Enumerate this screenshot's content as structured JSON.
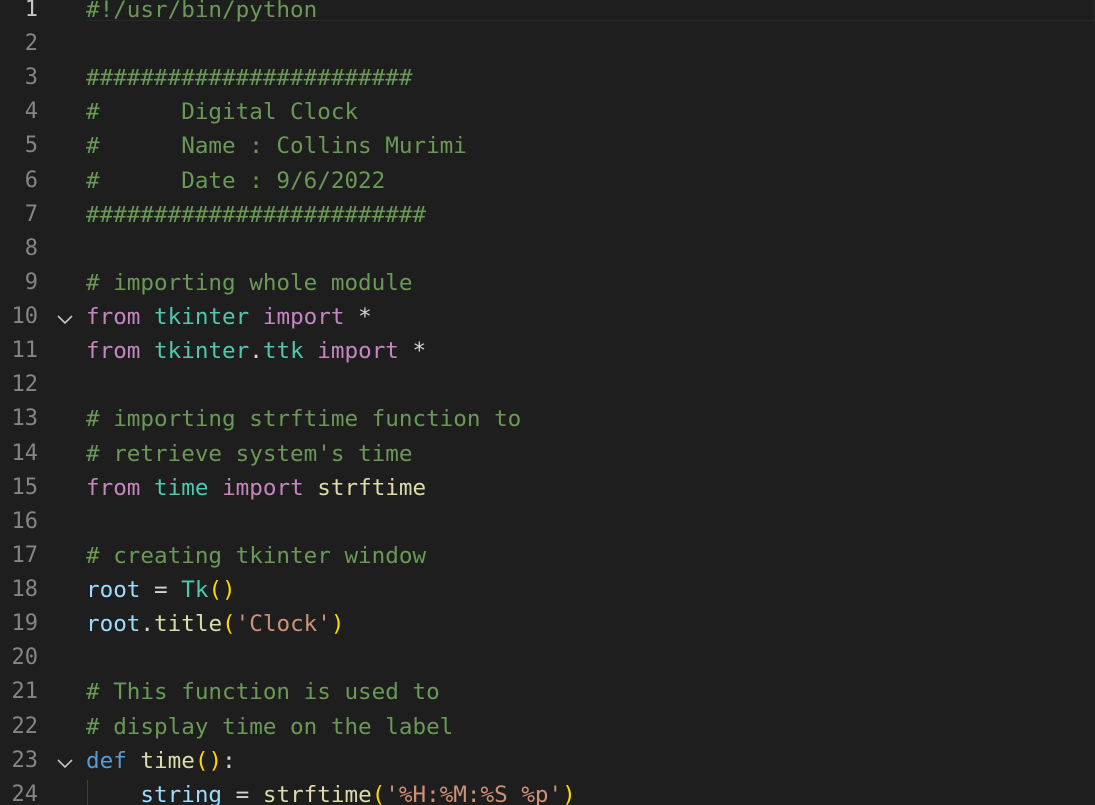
{
  "editor": {
    "theme_colors": {
      "background": "#1e1e1e",
      "line_number": "#858585",
      "comment": "#6a9955",
      "keyword": "#c586c0",
      "module": "#4ec9b0",
      "variable": "#9cdcfe",
      "function": "#dcdcaa",
      "string": "#ce9178",
      "bracket": "#ffd700"
    },
    "current_line": 1,
    "lines": [
      {
        "num": "1",
        "fold": "",
        "tokens": [
          {
            "t": "#!/usr/bin/python",
            "c": "comment"
          }
        ]
      },
      {
        "num": "2",
        "fold": "",
        "tokens": []
      },
      {
        "num": "3",
        "fold": "",
        "tokens": [
          {
            "t": "########################",
            "c": "comment"
          }
        ]
      },
      {
        "num": "4",
        "fold": "",
        "tokens": [
          {
            "t": "#      Digital Clock",
            "c": "comment"
          }
        ]
      },
      {
        "num": "5",
        "fold": "",
        "tokens": [
          {
            "t": "#      Name : Collins Murimi",
            "c": "comment"
          }
        ]
      },
      {
        "num": "6",
        "fold": "",
        "tokens": [
          {
            "t": "#      Date : 9/6/2022",
            "c": "comment"
          }
        ]
      },
      {
        "num": "7",
        "fold": "",
        "tokens": [
          {
            "t": "#########################",
            "c": "comment"
          }
        ]
      },
      {
        "num": "8",
        "fold": "",
        "tokens": []
      },
      {
        "num": "9",
        "fold": "",
        "tokens": [
          {
            "t": "# importing whole module",
            "c": "comment"
          }
        ]
      },
      {
        "num": "10",
        "fold": "chevron-down",
        "tokens": [
          {
            "t": "from",
            "c": "keyword"
          },
          {
            "t": " ",
            "c": "plain"
          },
          {
            "t": "tkinter",
            "c": "module"
          },
          {
            "t": " ",
            "c": "plain"
          },
          {
            "t": "import",
            "c": "keyword"
          },
          {
            "t": " *",
            "c": "plain"
          }
        ]
      },
      {
        "num": "11",
        "fold": "",
        "tokens": [
          {
            "t": "from",
            "c": "keyword"
          },
          {
            "t": " ",
            "c": "plain"
          },
          {
            "t": "tkinter",
            "c": "module"
          },
          {
            "t": ".",
            "c": "plain"
          },
          {
            "t": "ttk",
            "c": "module"
          },
          {
            "t": " ",
            "c": "plain"
          },
          {
            "t": "import",
            "c": "keyword"
          },
          {
            "t": " *",
            "c": "plain"
          }
        ]
      },
      {
        "num": "12",
        "fold": "",
        "tokens": []
      },
      {
        "num": "13",
        "fold": "",
        "tokens": [
          {
            "t": "# importing strftime function to",
            "c": "comment"
          }
        ]
      },
      {
        "num": "14",
        "fold": "",
        "tokens": [
          {
            "t": "# retrieve system's time",
            "c": "comment"
          }
        ]
      },
      {
        "num": "15",
        "fold": "",
        "tokens": [
          {
            "t": "from",
            "c": "keyword"
          },
          {
            "t": " ",
            "c": "plain"
          },
          {
            "t": "time",
            "c": "module"
          },
          {
            "t": " ",
            "c": "plain"
          },
          {
            "t": "import",
            "c": "keyword"
          },
          {
            "t": " ",
            "c": "plain"
          },
          {
            "t": "strftime",
            "c": "func"
          }
        ]
      },
      {
        "num": "16",
        "fold": "",
        "tokens": []
      },
      {
        "num": "17",
        "fold": "",
        "tokens": [
          {
            "t": "# creating tkinter window",
            "c": "comment"
          }
        ]
      },
      {
        "num": "18",
        "fold": "",
        "tokens": [
          {
            "t": "root",
            "c": "var"
          },
          {
            "t": " = ",
            "c": "plain"
          },
          {
            "t": "Tk",
            "c": "class"
          },
          {
            "t": "()",
            "c": "paren"
          }
        ]
      },
      {
        "num": "19",
        "fold": "",
        "tokens": [
          {
            "t": "root",
            "c": "var"
          },
          {
            "t": ".",
            "c": "plain"
          },
          {
            "t": "title",
            "c": "func"
          },
          {
            "t": "(",
            "c": "paren"
          },
          {
            "t": "'Clock'",
            "c": "string"
          },
          {
            "t": ")",
            "c": "paren"
          }
        ]
      },
      {
        "num": "20",
        "fold": "",
        "tokens": []
      },
      {
        "num": "21",
        "fold": "",
        "tokens": [
          {
            "t": "# This function is used to",
            "c": "comment"
          }
        ]
      },
      {
        "num": "22",
        "fold": "",
        "tokens": [
          {
            "t": "# display time on the label",
            "c": "comment"
          }
        ]
      },
      {
        "num": "23",
        "fold": "chevron-down",
        "tokens": [
          {
            "t": "def",
            "c": "def"
          },
          {
            "t": " ",
            "c": "plain"
          },
          {
            "t": "time",
            "c": "func"
          },
          {
            "t": "()",
            "c": "paren"
          },
          {
            "t": ":",
            "c": "plain"
          }
        ]
      },
      {
        "num": "24",
        "fold": "",
        "tokens": [
          {
            "t": "    ",
            "c": "plain"
          },
          {
            "t": "string",
            "c": "var"
          },
          {
            "t": " = ",
            "c": "plain"
          },
          {
            "t": "strftime",
            "c": "func"
          },
          {
            "t": "(",
            "c": "paren"
          },
          {
            "t": "'%H:%M:%S %p'",
            "c": "string"
          },
          {
            "t": ")",
            "c": "paren"
          }
        ]
      }
    ]
  }
}
